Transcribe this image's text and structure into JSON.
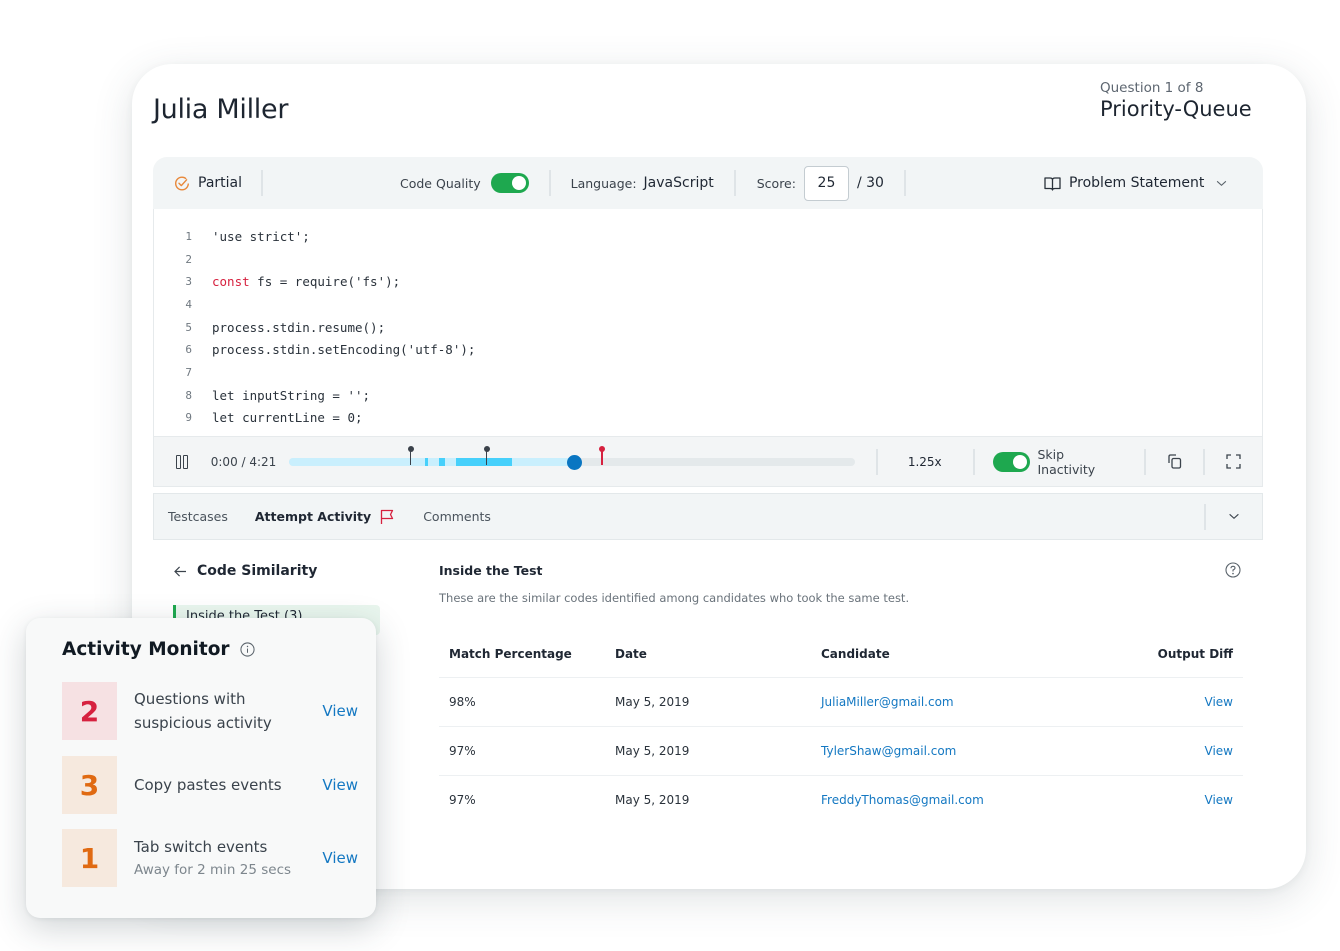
{
  "candidate": {
    "name": "Julia Miller"
  },
  "question": {
    "counter": "Question 1 of 8",
    "title": "Priority-Queue"
  },
  "toolbar": {
    "status_label": "Partial",
    "code_quality_label": "Code Quality",
    "code_quality_enabled": true,
    "language_label": "Language:",
    "language_value": "JavaScript",
    "score_label": "Score:",
    "score_value": "25",
    "score_total": "/ 30",
    "problem_statement_label": "Problem Statement"
  },
  "code": {
    "lines": [
      {
        "n": "1",
        "text": "'use strict';"
      },
      {
        "n": "2",
        "text": ""
      },
      {
        "n": "3",
        "kw": "const",
        "text": " fs = require('fs');"
      },
      {
        "n": "4",
        "text": ""
      },
      {
        "n": "5",
        "text": "process.stdin.resume();"
      },
      {
        "n": "6",
        "text": "process.stdin.setEncoding('utf-8');"
      },
      {
        "n": "7",
        "text": ""
      },
      {
        "n": "8",
        "text": "let inputString = '';"
      },
      {
        "n": "9",
        "text": "let currentLine = 0;"
      }
    ]
  },
  "player": {
    "time": "0:00 / 4:21",
    "progress": 0.494,
    "activity_segments": [
      [
        0.236,
        0.241
      ],
      [
        0.259,
        0.271
      ],
      [
        0.29,
        0.387
      ]
    ],
    "markers": [
      {
        "pos": 0.211,
        "color": "#3a414a"
      },
      {
        "pos": 0.343,
        "color": "#3a414a"
      },
      {
        "pos": 0.543,
        "color": "#d6213f"
      }
    ],
    "speed": "1.25x",
    "skip_inactivity_label": "Skip Inactivity",
    "skip_inactivity_enabled": true
  },
  "tabs": {
    "items": [
      {
        "label": "Testcases"
      },
      {
        "label": "Attempt Activity",
        "active": true
      },
      {
        "label": "Comments"
      }
    ]
  },
  "similarity": {
    "back_label": "Code Similarity",
    "side_item": "Inside the Test (3)",
    "section_title": "Inside the Test",
    "section_desc": "These are the similar codes identified among candidates who took the same test.",
    "columns": [
      "Match Percentage",
      "Date",
      "Candidate",
      "Output Diff"
    ],
    "rows": [
      {
        "match": "98%",
        "date": "May 5, 2019",
        "candidate": "JuliaMiller@gmail.com",
        "diff": "View"
      },
      {
        "match": "97%",
        "date": "May 5, 2019",
        "candidate": "TylerShaw@gmail.com",
        "diff": "View"
      },
      {
        "match": "97%",
        "date": "May 5, 2019",
        "candidate": "FreddyThomas@gmail.com",
        "diff": "View"
      }
    ]
  },
  "monitor": {
    "title": "Activity Monitor",
    "items": [
      {
        "count": "2",
        "label": "Questions with suspicious activity",
        "sub": "",
        "view": "View",
        "color": "#d6213f",
        "bg": "#f6e1e3"
      },
      {
        "count": "3",
        "label": "Copy pastes events",
        "sub": "",
        "view": "View",
        "color": "#e06a12",
        "bg": "#f6e9de"
      },
      {
        "count": "1",
        "label": "Tab switch events",
        "sub": "Away for 2 min 25 secs",
        "view": "View",
        "color": "#e06a12",
        "bg": "#f6e9de"
      }
    ]
  },
  "colors": {
    "accent_green": "#1ea84f",
    "link_blue": "#1478c2",
    "flag_red": "#d6213f",
    "partial_orange": "#e8883a"
  }
}
